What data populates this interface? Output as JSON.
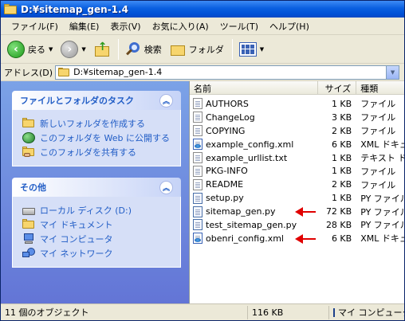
{
  "window": {
    "title": "D:¥sitemap_gen-1.4"
  },
  "menubar": {
    "items": [
      "ファイル(F)",
      "編集(E)",
      "表示(V)",
      "お気に入り(A)",
      "ツール(T)",
      "ヘルプ(H)"
    ]
  },
  "toolbar": {
    "back_label": "戻る",
    "search_label": "検索",
    "folders_label": "フォルダ"
  },
  "address": {
    "label": "アドレス(D)",
    "value": "D:¥sitemap_gen-1.4"
  },
  "tasks": {
    "file_folder": {
      "title": "ファイルとフォルダのタスク",
      "links": [
        "新しいフォルダを作成する",
        "このフォルダを Web に公開する",
        "このフォルダを共有する"
      ]
    },
    "other": {
      "title": "その他",
      "links": [
        "ローカル ディスク (D:)",
        "マイ ドキュメント",
        "マイ コンピュータ",
        "マイ ネットワーク"
      ]
    }
  },
  "filelist": {
    "columns": {
      "name": "名前",
      "size": "サイズ",
      "type": "種類"
    },
    "rows": [
      {
        "name": "AUTHORS",
        "size": "1 KB",
        "type": "ファイル",
        "icon": "text-file-icon"
      },
      {
        "name": "ChangeLog",
        "size": "3 KB",
        "type": "ファイル",
        "icon": "text-file-icon"
      },
      {
        "name": "COPYING",
        "size": "2 KB",
        "type": "ファイル",
        "icon": "text-file-icon"
      },
      {
        "name": "example_config.xml",
        "size": "6 KB",
        "type": "XML ドキュメント",
        "icon": "xml-file-icon"
      },
      {
        "name": "example_urllist.txt",
        "size": "1 KB",
        "type": "テキスト ドキュメント",
        "icon": "text-file-icon"
      },
      {
        "name": "PKG-INFO",
        "size": "1 KB",
        "type": "ファイル",
        "icon": "text-file-icon"
      },
      {
        "name": "README",
        "size": "2 KB",
        "type": "ファイル",
        "icon": "text-file-icon"
      },
      {
        "name": "setup.py",
        "size": "1 KB",
        "type": "PY ファイル",
        "icon": "python-file-icon"
      },
      {
        "name": "sitemap_gen.py",
        "size": "72 KB",
        "type": "PY ファイル",
        "icon": "python-file-icon",
        "highlighted": true
      },
      {
        "name": "test_sitemap_gen.py",
        "size": "28 KB",
        "type": "PY ファイル",
        "icon": "python-file-icon"
      },
      {
        "name": "obenri_config.xml",
        "size": "6 KB",
        "type": "XML ドキュメント",
        "icon": "xml-file-icon",
        "highlighted": true
      }
    ]
  },
  "statusbar": {
    "objects": "11 個のオブジェクト",
    "size": "116 KB",
    "zone": "マイ コンピュータ"
  },
  "colors": {
    "title_bar": "#0a5fe0",
    "task_pane": "#6375d6",
    "task_link": "#215dc6",
    "annotation_arrow": "#e00000"
  }
}
